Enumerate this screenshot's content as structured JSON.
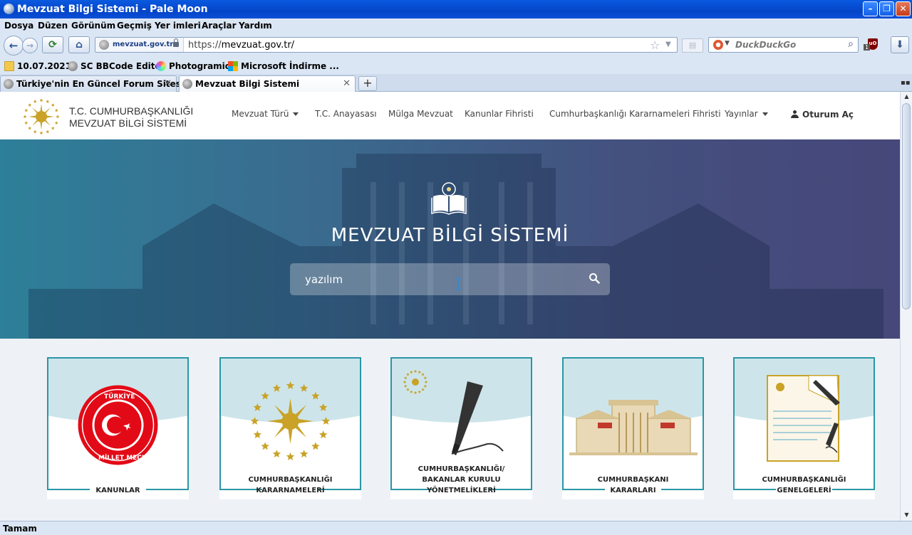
{
  "window": {
    "title": "Mevzuat Bilgi Sistemi - Pale Moon"
  },
  "menu": [
    "Dosya",
    "Düzen",
    "Görünüm",
    "Geçmiş",
    "Yer imleri",
    "Araçlar",
    "Yardım"
  ],
  "navbar": {
    "site_identity": "mevzuat.gov.tr",
    "url_scheme": "https://",
    "url_host": "mevzuat.gov.tr/",
    "search_placeholder": "DuckDuckGo",
    "ublock_count": "1",
    "ublock_label": "uO"
  },
  "bookmarks": [
    {
      "label": "10.07.2021",
      "icon": "folder-icon"
    },
    {
      "label": "SC BBCode Editor",
      "icon": "globe-icon"
    },
    {
      "label": "Photogramio",
      "icon": "photogramio-icon"
    },
    {
      "label": "Microsoft İndirme ...",
      "icon": "microsoft-icon"
    }
  ],
  "tabs": [
    {
      "label": "Türkiye'nin En Güncel Forum Sitesi",
      "active": false
    },
    {
      "label": "Mevzuat Bilgi Sistemi",
      "active": true
    }
  ],
  "site": {
    "brand_line1": "T.C. CUMHURBAŞKANLIĞI",
    "brand_line2": "MEVZUAT BİLGİ SİSTEMİ",
    "nav": [
      "Mevzuat Türü",
      "T.C. Anayasası",
      "Mülga Mevzuat",
      "Kanunlar Fihristi",
      "Cumhurbaşkanlığı Kararnameleri Fihristi",
      "Yayınlar"
    ],
    "login": "Oturum Aç",
    "hero_title": "MEVZUAT BİLGİ SİSTEMİ",
    "search_value": "yazılım",
    "cards": [
      {
        "lines": [
          "KANUNLAR"
        ],
        "icon": "tbmm-seal-icon"
      },
      {
        "lines": [
          "CUMHURBAŞKANLIĞI",
          "KARARNAMELERİ"
        ],
        "icon": "presidential-emblem-icon"
      },
      {
        "lines": [
          "CUMHURBAŞKANLIĞI/",
          "BAKANLAR KURULU",
          "YÖNETMELİKLERİ"
        ],
        "icon": "pen-icon"
      },
      {
        "lines": [
          "CUMHURBAŞKANI",
          "KARARLARI"
        ],
        "icon": "presidential-complex-icon"
      },
      {
        "lines": [
          "CUMHURBAŞKANLIĞI",
          "GENELGELERİ"
        ],
        "icon": "circular-document-icon"
      }
    ]
  },
  "status": "Tamam",
  "colors": {
    "accent": "#2a97a6",
    "hero_start": "#2e7f99",
    "hero_end": "#46477a",
    "gold": "#c9a227",
    "red": "#e30a17"
  }
}
